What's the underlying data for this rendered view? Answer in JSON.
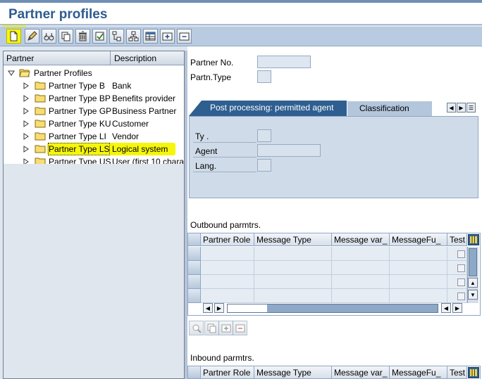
{
  "app": {
    "title": "Partner profiles"
  },
  "toolbar": {
    "buttons": [
      {
        "name": "create-button",
        "icon": "new-document-icon"
      },
      {
        "name": "change-button",
        "icon": "pencil-icon"
      },
      {
        "name": "display-button",
        "icon": "glasses-icon"
      },
      {
        "name": "copy-button",
        "icon": "copy-icon"
      },
      {
        "name": "delete-button",
        "icon": "trash-icon"
      },
      {
        "name": "check-button",
        "icon": "check-icon"
      },
      {
        "name": "other-button",
        "icon": "structure-icon"
      },
      {
        "name": "hierarchy-button",
        "icon": "hierarchy-icon"
      },
      {
        "name": "table-button",
        "icon": "table-icon"
      },
      {
        "name": "add-button",
        "icon": "add-icon"
      },
      {
        "name": "remove-button",
        "icon": "remove-icon"
      }
    ],
    "highlight_color": "#f6f60a"
  },
  "tree": {
    "columns": {
      "partner": "Partner",
      "description": "Description"
    },
    "root": {
      "label": "Partner Profiles"
    },
    "items": [
      {
        "partner": "Partner Type B",
        "description": "Bank"
      },
      {
        "partner": "Partner Type BP",
        "description": "Benefits provider"
      },
      {
        "partner": "Partner Type GP",
        "description": "Business Partner"
      },
      {
        "partner": "Partner Type KU",
        "description": "Customer"
      },
      {
        "partner": "Partner Type LI",
        "description": "Vendor"
      },
      {
        "partner": "Partner Type LS",
        "description": "Logical system"
      },
      {
        "partner": "Partner Type US",
        "description": "User (first 10 chara"
      }
    ],
    "selected_index": 5
  },
  "header_fields": {
    "partner_no_label": "Partner No.",
    "partner_no_value": "",
    "partn_type_label": "Partn.Type",
    "partn_type_value": ""
  },
  "tabs": {
    "active": "Post processing: permitted agent",
    "second": "Classification"
  },
  "tab_fields": {
    "ty_label": "Ty .",
    "agent_label": "Agent",
    "lang_label": "Lang."
  },
  "outbound": {
    "title": "Outbound parmtrs.",
    "columns": [
      "Partner Role",
      "Message Type",
      "Message var_",
      "MessageFu_",
      "Test"
    ]
  },
  "inbound": {
    "title": "Inbound parmtrs.",
    "columns": [
      "Partner Role",
      "Message Type",
      "Message var_",
      "MessageFu_",
      "Test"
    ]
  }
}
